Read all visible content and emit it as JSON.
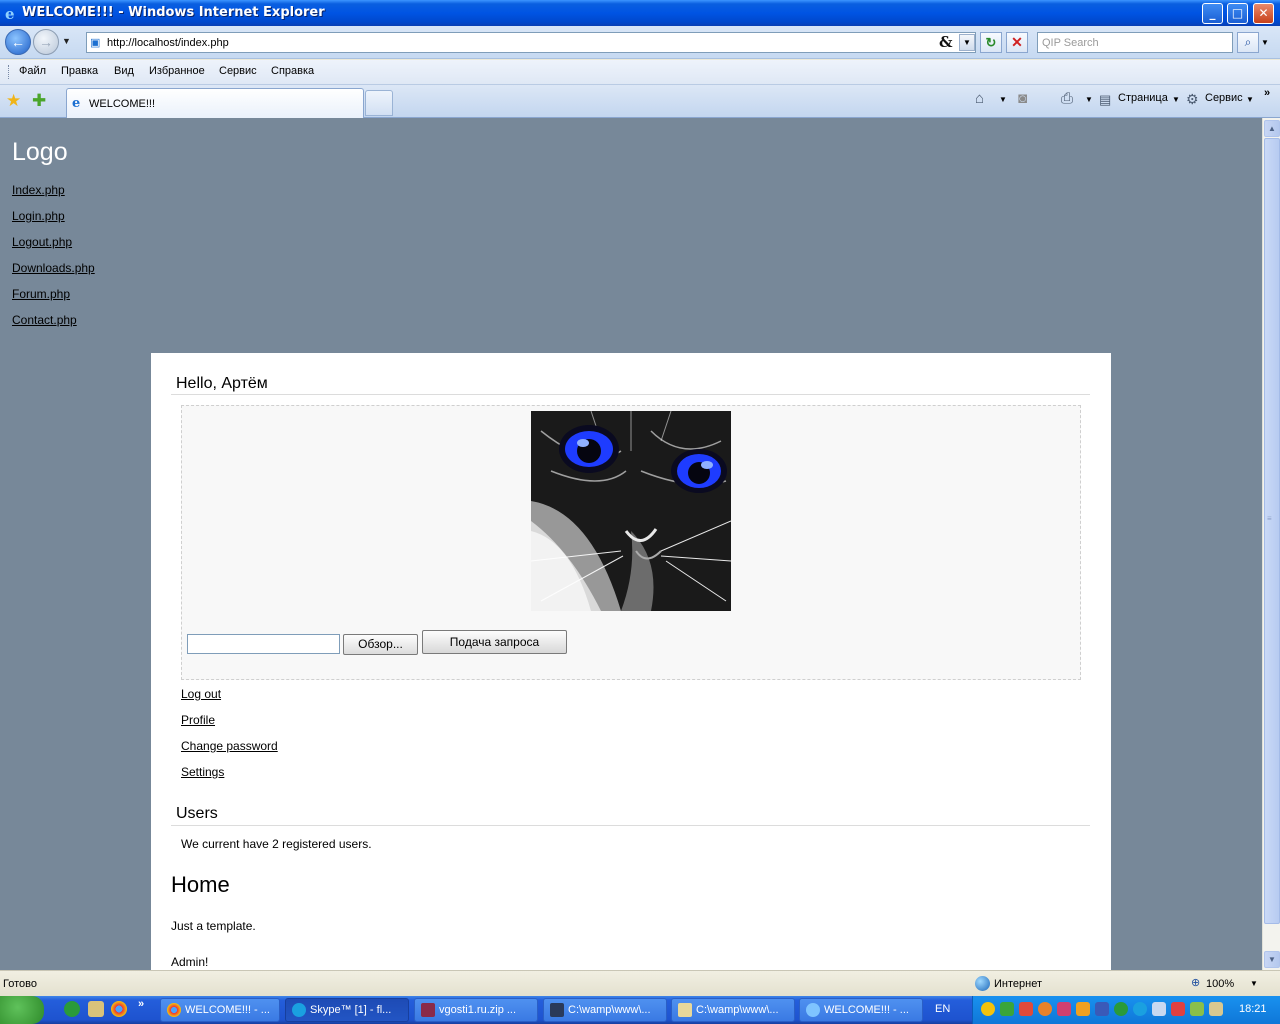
{
  "window": {
    "title": "WELCOME!!! - Windows Internet Explorer"
  },
  "address_bar": {
    "url": "http://localhost/index.php",
    "compat_icon": "&",
    "search_placeholder": "QIP Search"
  },
  "menu": [
    "Файл",
    "Правка",
    "Вид",
    "Избранное",
    "Сервис",
    "Справка"
  ],
  "tab": {
    "title": "WELCOME!!!"
  },
  "command_bar": {
    "page_label": "Страница",
    "tools_label": "Сервис"
  },
  "page": {
    "logo": "Logo",
    "nav": [
      "Index.php",
      "Login.php",
      "Logout.php",
      "Downloads.php",
      "Forum.php",
      "Contact.php"
    ],
    "greeting": "Hello, Артём",
    "upload": {
      "browse_label": "Обзор...",
      "submit_label": "Подача запроса"
    },
    "user_links": [
      "Log out",
      "Profile",
      "Change password",
      "Settings"
    ],
    "users_heading": "Users",
    "users_text": "We current have 2 registered users.",
    "home_heading": "Home",
    "home_text": "Just a template.",
    "home_author": "Admin!"
  },
  "status_bar": {
    "status": "Готово",
    "zone": "Интернет",
    "zoom": "100%"
  },
  "taskbar": {
    "buttons": [
      "WELCOME!!! - ...",
      "Skype™ [1] - fl...",
      "vgosti1.ru.zip ...",
      "C:\\wamp\\www\\...",
      "C:\\wamp\\www\\...",
      "WELCOME!!! - ..."
    ],
    "language": "EN",
    "clock": "18:21"
  },
  "colors": {
    "page_background": "#778899",
    "content_background": "#ffffff",
    "titlebar": "#0054e3"
  }
}
